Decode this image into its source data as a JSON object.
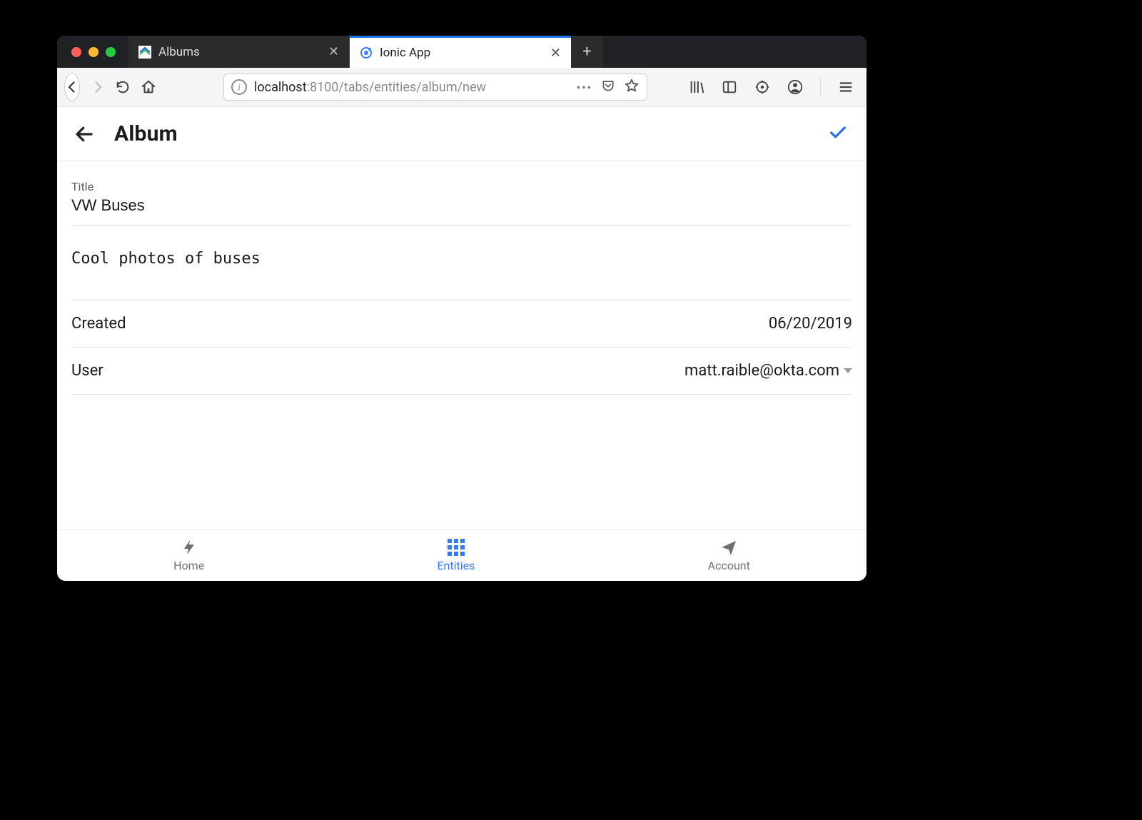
{
  "browser": {
    "tabs": [
      {
        "label": "Albums",
        "active": false
      },
      {
        "label": "Ionic App",
        "active": true
      }
    ],
    "url_host": "localhost",
    "url_path": ":8100/tabs/entities/album/new"
  },
  "header": {
    "title": "Album"
  },
  "form": {
    "title_label": "Title",
    "title_value": "VW Buses",
    "description_value": "Cool photos of buses",
    "created_label": "Created",
    "created_value": "06/20/2019",
    "user_label": "User",
    "user_value": "matt.raible@okta.com"
  },
  "tabbar": {
    "home": "Home",
    "entities": "Entities",
    "account": "Account"
  }
}
